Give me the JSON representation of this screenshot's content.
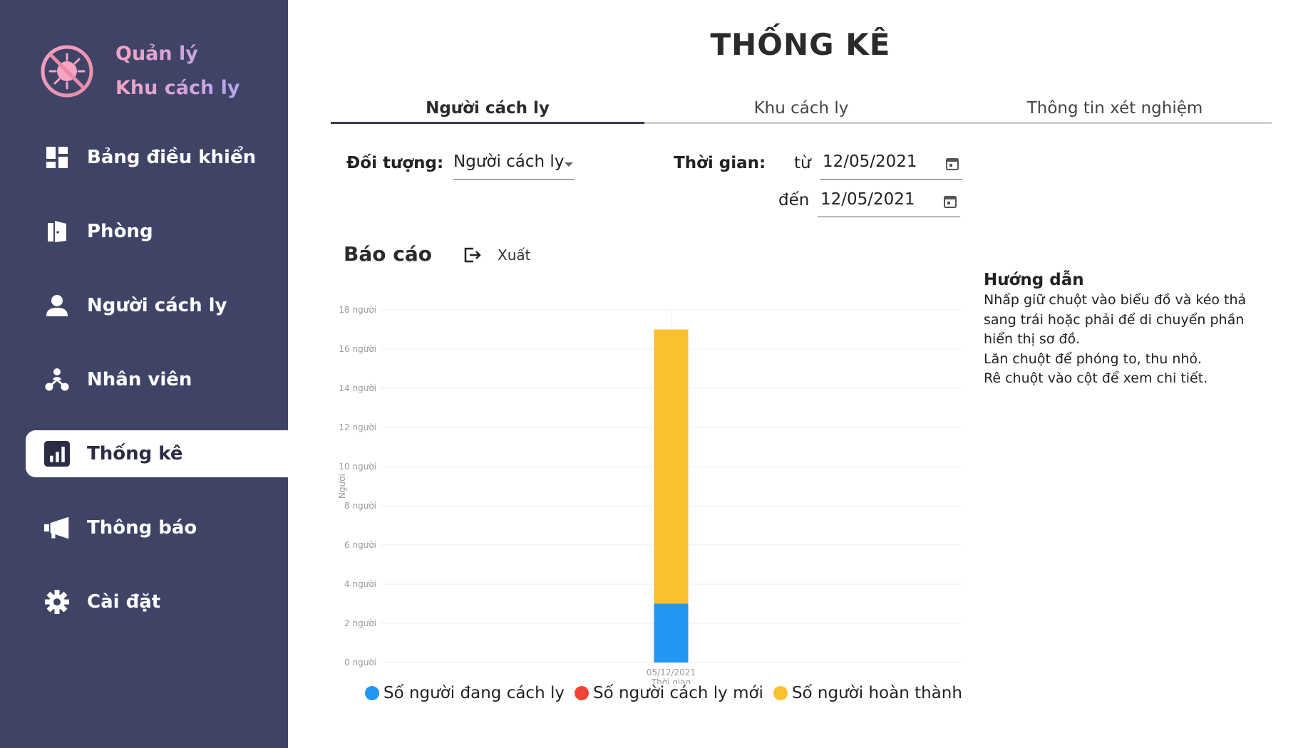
{
  "brand": {
    "line1": "Quản lý",
    "line2": "Khu cách ly"
  },
  "nav": [
    {
      "label": "Bảng điều khiển",
      "icon": "dashboard-icon"
    },
    {
      "label": "Phòng",
      "icon": "door-icon"
    },
    {
      "label": "Người cách ly",
      "icon": "person-icon"
    },
    {
      "label": "Nhân viên",
      "icon": "staff-icon"
    },
    {
      "label": "Thống kê",
      "icon": "bar-chart-icon",
      "active": true
    },
    {
      "label": "Thông báo",
      "icon": "megaphone-icon"
    },
    {
      "label": "Cài đặt",
      "icon": "gear-icon"
    }
  ],
  "page": {
    "title": "THỐNG KÊ"
  },
  "tabs": [
    "Người cách ly",
    "Khu cách ly",
    "Thông tin xét nghiệm"
  ],
  "filters": {
    "subject_label": "Đối tượng:",
    "subject_value": "Người cách ly",
    "time_label": "Thời gian:",
    "from_label": "từ",
    "from_value": "12/05/2021",
    "to_label": "đến",
    "to_value": "12/05/2021"
  },
  "report": {
    "title": "Báo cáo",
    "export_label": "Xuất"
  },
  "guide": {
    "title": "Hướng dẫn",
    "lines": [
      "Nhấp giữ chuột vào biểu đồ và kéo thả",
      "sang trái hoặc phải để di chuyển phần",
      "hiển thị sơ đồ.",
      "Lăn chuột để phóng to, thu nhỏ.",
      "Rê chuột vào cột để xem chi tiết."
    ]
  },
  "colors": {
    "sidebar": "#3f4467",
    "blue": "#2196f3",
    "red": "#f44336",
    "yellow": "#fbc02d"
  },
  "chart_data": {
    "type": "bar",
    "stacked": true,
    "categories": [
      "05/12/2021"
    ],
    "xlabel": "Thời gian",
    "ylabel": "Người",
    "ylim": [
      0,
      18
    ],
    "yticks": [
      "0 người",
      "2 người",
      "4 người",
      "6 người",
      "8 người",
      "10 người",
      "12 người",
      "14 người",
      "16 người",
      "18 người"
    ],
    "series": [
      {
        "name": "Số người đang cách ly",
        "color": "#2196f3",
        "values": [
          3
        ]
      },
      {
        "name": "Số người cách ly mới",
        "color": "#f44336",
        "values": [
          0
        ]
      },
      {
        "name": "Số người hoàn thành",
        "color": "#fbc02d",
        "values": [
          14
        ]
      }
    ]
  }
}
